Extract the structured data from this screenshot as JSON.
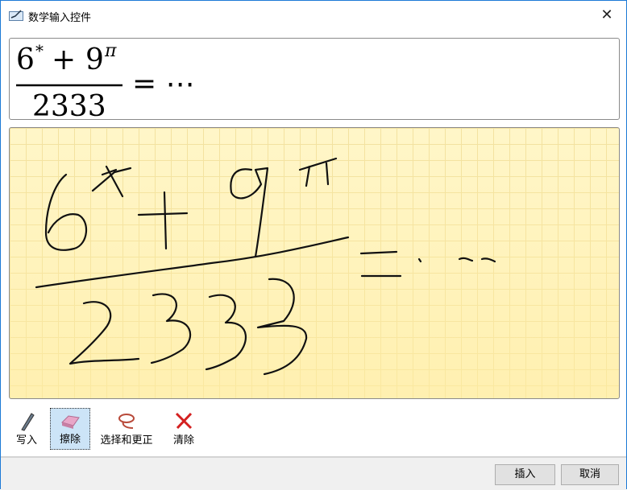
{
  "window": {
    "title": "数学输入控件",
    "close": "✕"
  },
  "preview": {
    "numerator": "6* + 9π",
    "denominator": "2333",
    "equals": "= ⋯"
  },
  "toolbar": [
    {
      "label": "写入",
      "icon": "pen-icon"
    },
    {
      "label": "擦除",
      "icon": "eraser-icon",
      "selected": true
    },
    {
      "label": "选择和更正",
      "icon": "lasso-icon"
    },
    {
      "label": "清除",
      "icon": "clear-x-icon"
    }
  ],
  "buttons": {
    "insert": "插入",
    "cancel": "取消"
  }
}
